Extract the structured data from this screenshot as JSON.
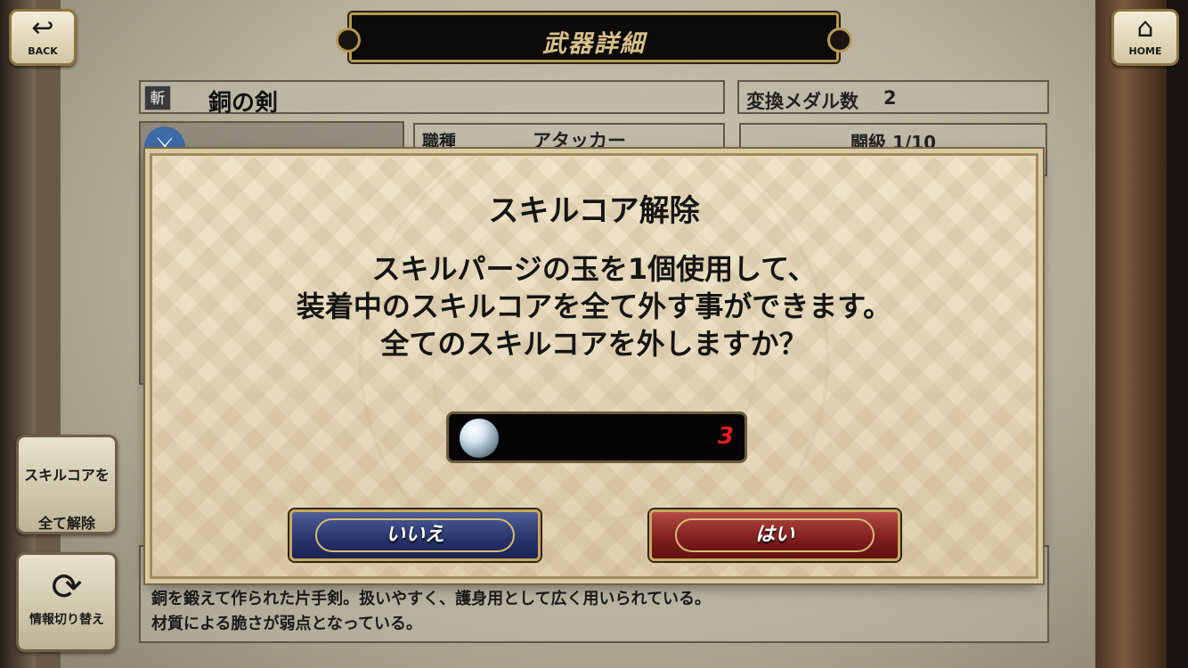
{
  "header": {
    "title": "武器詳細",
    "back_label": "BACK",
    "home_label": "HOME"
  },
  "weapon": {
    "type_tag": "斬",
    "name": "銅の剣",
    "medal_label": "変換メダル数",
    "medal_value": "2",
    "job_label": "職種",
    "job_value": "アタッカー",
    "rank_label": "闘級 1/10",
    "description_line1": "銅を鍛えて作られた片手剣。扱いやすく、護身用として広く用いられている。",
    "description_line2": "材質による脆さが弱点となっている。"
  },
  "side_buttons": {
    "skill_release_label_1": "スキルコアを",
    "skill_release_label_2": "全て解除",
    "switch_info_label": "情報切り替え"
  },
  "dialog": {
    "title": "スキルコア解除",
    "message_line1": "スキルパージの玉を1個使用して、",
    "message_line2": "装着中のスキルコアを全て外す事ができます。",
    "message_line3": "全てのスキルコアを外しますか？",
    "item_count": "3",
    "no_label": "いいえ",
    "yes_label": "はい"
  }
}
